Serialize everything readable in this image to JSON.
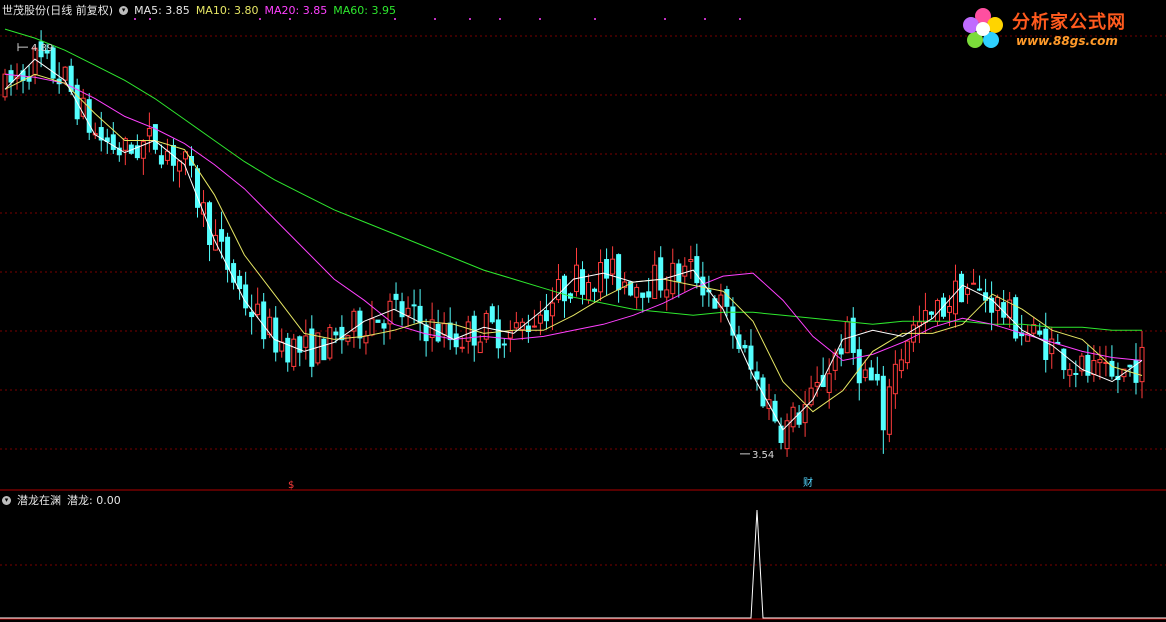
{
  "header": {
    "stock_label": "世茂股份(日线 前复权)",
    "ma5": "MA5: 3.85",
    "ma10": "MA10: 3.80",
    "ma20": "MA20: 3.85",
    "ma60": "MA60: 3.95"
  },
  "indicator_header": {
    "name": "潜龙在渊",
    "value_label": "潜龙: 0.00"
  },
  "logo": {
    "brand": "分析家公式网",
    "url": "www.88gs.com"
  },
  "colors": {
    "up": "#ff3c3c",
    "down": "#54ffff",
    "ma5": "#ffffff",
    "ma10": "#e6e664",
    "ma20": "#ff40ff",
    "ma60": "#2ee82e",
    "grid": "#7a0000",
    "axis": "#b00000"
  },
  "chart_data": [
    {
      "type": "candlestick",
      "high_label": "4.89",
      "low_label": "3.54",
      "high_value": 4.89,
      "low_value": 3.54,
      "ylim": [
        3.44,
        5.0
      ],
      "markers": [
        "$",
        "财"
      ],
      "ma60": [
        4.95,
        4.92,
        4.88,
        4.83,
        4.78,
        4.72,
        4.65,
        4.58,
        4.51,
        4.45,
        4.4,
        4.35,
        4.31,
        4.27,
        4.23,
        4.19,
        4.15,
        4.12,
        4.09,
        4.06,
        4.04,
        4.02,
        4.01,
        4.0,
        4.01,
        4.01,
        4.0,
        3.99,
        3.98,
        3.97,
        3.98,
        3.98,
        3.98,
        3.97,
        3.97,
        3.96,
        3.96,
        3.95,
        3.95
      ],
      "ma20": [
        4.8,
        4.79,
        4.77,
        4.72,
        4.66,
        4.62,
        4.57,
        4.5,
        4.42,
        4.32,
        4.22,
        4.12,
        4.05,
        3.97,
        3.94,
        3.92,
        3.93,
        3.92,
        3.93,
        3.95,
        3.97,
        4.0,
        4.04,
        4.09,
        4.13,
        4.14,
        4.05,
        3.93,
        3.85,
        3.87,
        3.91,
        3.96,
        3.99,
        3.97,
        3.94,
        3.91,
        3.88,
        3.86,
        3.85
      ],
      "ma10": [
        4.75,
        4.8,
        4.77,
        4.67,
        4.58,
        4.58,
        4.55,
        4.4,
        4.2,
        4.07,
        3.94,
        3.92,
        3.93,
        3.95,
        3.98,
        3.97,
        3.94,
        3.95,
        3.95,
        4.0,
        4.06,
        4.11,
        4.12,
        4.1,
        4.08,
        3.98,
        3.78,
        3.68,
        3.75,
        3.88,
        3.94,
        3.94,
        3.97,
        4.07,
        4.02,
        3.95,
        3.92,
        3.83,
        3.8
      ],
      "ma5": [
        4.75,
        4.85,
        4.78,
        4.6,
        4.54,
        4.58,
        4.5,
        4.25,
        4.05,
        3.92,
        3.88,
        3.91,
        3.98,
        4.02,
        3.97,
        3.92,
        3.96,
        3.94,
        4.02,
        4.12,
        4.14,
        4.11,
        4.12,
        4.15,
        4.02,
        3.8,
        3.62,
        3.72,
        3.92,
        3.95,
        3.93,
        3.99,
        4.1,
        4.05,
        3.95,
        3.9,
        3.82,
        3.78,
        3.85
      ]
    },
    {
      "type": "line",
      "name": "潜龙",
      "value": 0.0,
      "spike_value": 1.0,
      "ylim": [
        0,
        1.0
      ]
    }
  ]
}
